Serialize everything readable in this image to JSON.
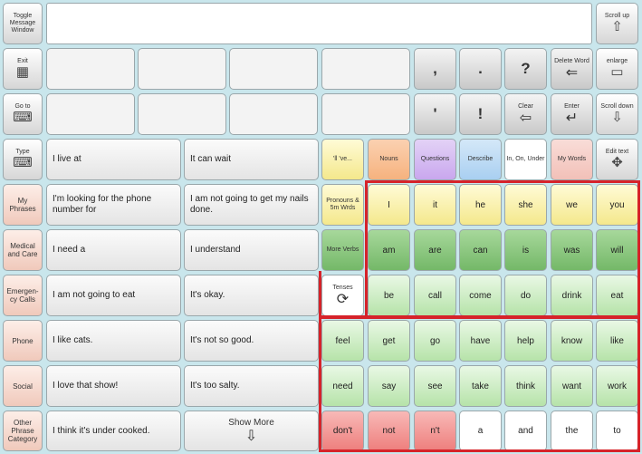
{
  "toolbar": {
    "toggle_message_window": "Toggle Message Window",
    "scroll_up": "Scroll up",
    "exit": "Exit",
    "go_to_home": "Go to",
    "type": "Type",
    "delete_word": "Delete Word",
    "enlarge": "enlarge",
    "clear": "Clear",
    "enter": "Enter",
    "scroll_down": "Scroll down",
    "edit_text": "Edit text"
  },
  "message_window": {
    "text": ""
  },
  "punctuation": [
    ",",
    ".",
    "?",
    "'",
    "!"
  ],
  "categories": [
    "My Phrases",
    "Medical and Care",
    "Emergen-cy Calls",
    "Phone",
    "Social",
    "Other Phrase Category"
  ],
  "phrases": {
    "col1": [
      "I live at",
      "I'm looking for the phone number for",
      "I need a",
      "I am not going to eat",
      "I like cats.",
      "I love that show!",
      "I think it's under cooked."
    ],
    "col2": [
      "It can wait",
      "I am not going to get my nails done.",
      "I understand",
      "It's okay.",
      "It's not so good.",
      "It's too salty."
    ],
    "show_more": "Show More"
  },
  "word_tabs": {
    "contractions": "'ll 've...",
    "nouns": "Nouns",
    "questions": "Questions",
    "describe": "Describe",
    "prepositions": "In, On, Under",
    "my_words": "My Words"
  },
  "grammar": {
    "pronouns": "Pronouns & 5m Wrds",
    "more_verbs": "More Verbs",
    "tenses": "Tenses"
  },
  "words": {
    "row1": [
      "I",
      "it",
      "he",
      "she",
      "we",
      "you"
    ],
    "row2": [
      "am",
      "are",
      "can",
      "is",
      "was",
      "will"
    ],
    "row3": [
      "be",
      "call",
      "come",
      "do",
      "drink",
      "eat"
    ],
    "row4": [
      "feel",
      "get",
      "go",
      "have",
      "help",
      "know",
      "like"
    ],
    "row5": [
      "need",
      "say",
      "see",
      "take",
      "think",
      "want",
      "work"
    ],
    "row6": [
      "don't",
      "not",
      "n't",
      "a",
      "and",
      "the",
      "to"
    ]
  },
  "colors": {
    "background": "#c9e6ec",
    "highlight_border": "#d6232a",
    "yellow": "#f4e88c",
    "green": "#74b868",
    "light_green": "#b6e3a9",
    "red": "#ee7f7d",
    "nouns": "#f6b27e",
    "questions": "#c9a7ee",
    "describe": "#a9cff1",
    "my_words": "#f2c0b8"
  }
}
